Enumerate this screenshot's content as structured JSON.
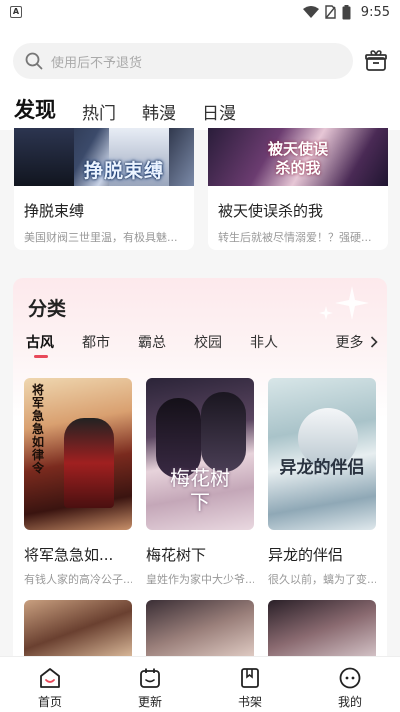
{
  "status_bar": {
    "time": "9:55"
  },
  "search": {
    "placeholder": "使用后不予退货"
  },
  "tabs": [
    {
      "label": "发现",
      "active": true
    },
    {
      "label": "热门",
      "active": false
    },
    {
      "label": "韩漫",
      "active": false
    },
    {
      "label": "日漫",
      "active": false
    }
  ],
  "featured": [
    {
      "title": "挣脱束缚",
      "desc": "美国财阀三世里温，有极具魅...",
      "cover_text": "挣脱束缚"
    },
    {
      "title": "被天使误杀的我",
      "desc": "转生后就被尽情溺爱！？强硬...",
      "cover_text": "被天使误杀的我"
    }
  ],
  "category": {
    "heading": "分类",
    "tabs": [
      "古风",
      "都市",
      "霸总",
      "校园",
      "非人"
    ],
    "more_label": "更多",
    "comics": [
      {
        "title": "将军急急如...",
        "desc": "有钱人家的高冷公子...",
        "cover_text": "将军急急如律令"
      },
      {
        "title": "梅花树下",
        "desc": "皇姓作为家中大少爷...",
        "cover_text": "梅花树下"
      },
      {
        "title": "异龙的伴侣",
        "desc": "很久以前，螭为了变...",
        "cover_text": "异龙的伴侣"
      }
    ]
  },
  "bottom_nav": [
    {
      "label": "首页",
      "icon": "home-icon"
    },
    {
      "label": "更新",
      "icon": "calendar-icon"
    },
    {
      "label": "书架",
      "icon": "bookmark-book-icon"
    },
    {
      "label": "我的",
      "icon": "profile-face-icon"
    }
  ],
  "colors": {
    "accent": "#e8495a",
    "panel_tint": "#fde9ec"
  }
}
